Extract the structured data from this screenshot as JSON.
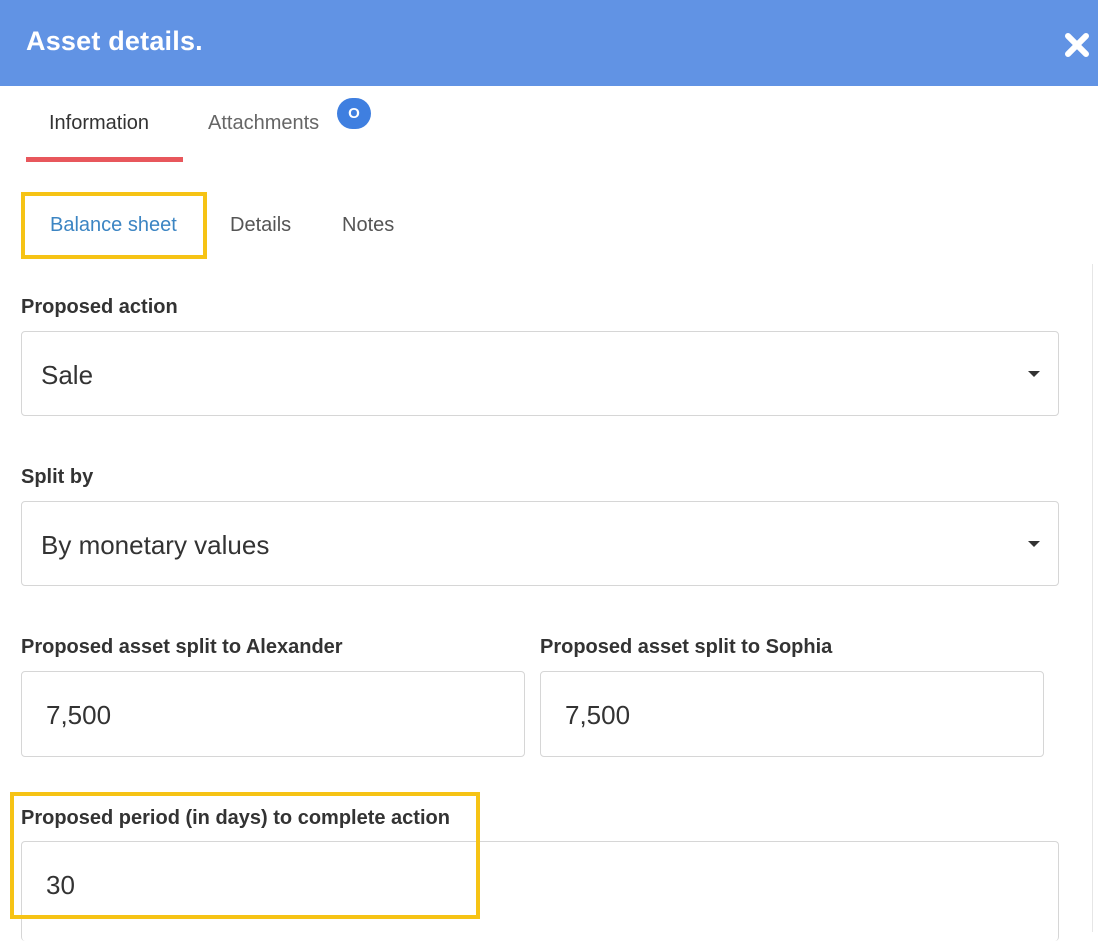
{
  "dialog": {
    "title": "Asset details.",
    "close_icon": "close-icon"
  },
  "tabs": {
    "main": [
      {
        "label": "Information",
        "active": true
      },
      {
        "label": "Attachments",
        "active": false,
        "badge": "O"
      }
    ],
    "sub": [
      {
        "label": "Balance sheet",
        "active": true
      },
      {
        "label": "Details",
        "active": false
      },
      {
        "label": "Notes",
        "active": false
      }
    ]
  },
  "form": {
    "proposed_action": {
      "label": "Proposed action",
      "value": "Sale"
    },
    "split_by": {
      "label": "Split by",
      "value": "By monetary values"
    },
    "split_alexander": {
      "label": "Proposed asset split to Alexander",
      "value": "7,500"
    },
    "split_sophia": {
      "label": "Proposed asset split to Sophia",
      "value": "7,500"
    },
    "period_days": {
      "label": "Proposed period (in days) to complete action",
      "value": "30"
    }
  },
  "colors": {
    "header": "#6193e4",
    "active_tab_underline": "#e8575c",
    "highlight": "#f6c315",
    "badge": "#3f7fe0",
    "active_subtab_text": "#3c85c3"
  }
}
